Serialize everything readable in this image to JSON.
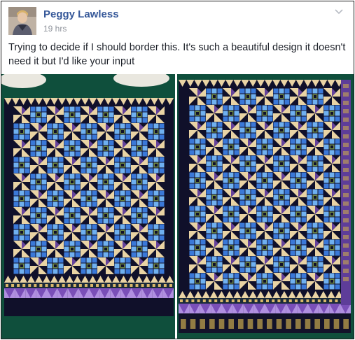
{
  "post": {
    "author": "Peggy Lawless",
    "timestamp": "19 hrs",
    "text": "Trying to decide if I should border this. It's such a beautiful design it doesn't need it but I'd like your input",
    "menu_icon": "chevron-down-icon",
    "avatar_icon": "profile-photo"
  },
  "photos": [
    {
      "subject": "quilt-without-border",
      "border": false
    },
    {
      "subject": "quilt-with-border",
      "border": true
    }
  ],
  "colors": {
    "author_link": "#365899",
    "timestamp": "#90949c",
    "body_text": "#1d2129",
    "carpet": "#0f4f3c",
    "quilt_navy": "#10102a",
    "quilt_blue": "#3a78d8",
    "quilt_cream": "#e9d3a4",
    "quilt_purple": "#7a4fb8",
    "quilt_olive": "#6f8a44"
  }
}
